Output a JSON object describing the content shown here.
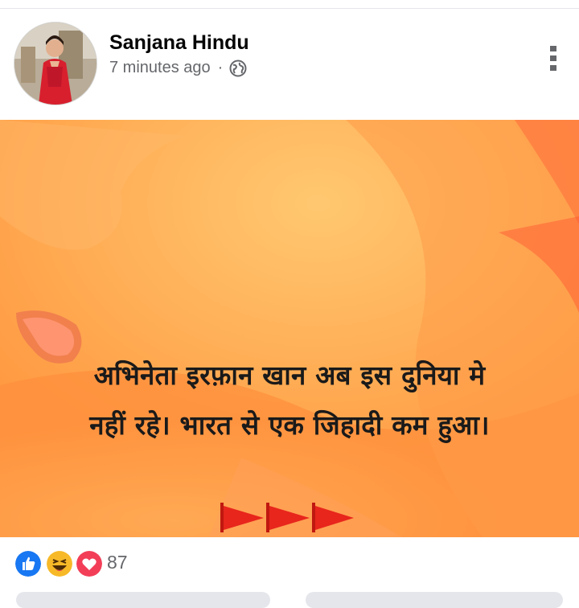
{
  "post": {
    "author": "Sanjana Hindu",
    "timestamp": "7 minutes ago",
    "separator": "·",
    "privacy_icon": "globe-icon",
    "more_icon": "vertical-ellipsis-icon"
  },
  "image": {
    "line1": "अभिनेता इरफ़ान खान अब इस दुनिया मे",
    "line2": "नहीं रहे। भारत से एक जिहादी कम हुआ।",
    "flag_icon": "saffron-flag-icon",
    "flag_count": 3,
    "colors": {
      "background": "#ffa24a",
      "flag": "#e8261c",
      "text": "#1a1a1a"
    }
  },
  "reactions": {
    "icons": [
      "like-icon",
      "haha-icon",
      "love-icon"
    ],
    "count": "87",
    "colors": {
      "like": "#1877f2",
      "haha": "#f7b928",
      "love": "#f33e58"
    }
  }
}
